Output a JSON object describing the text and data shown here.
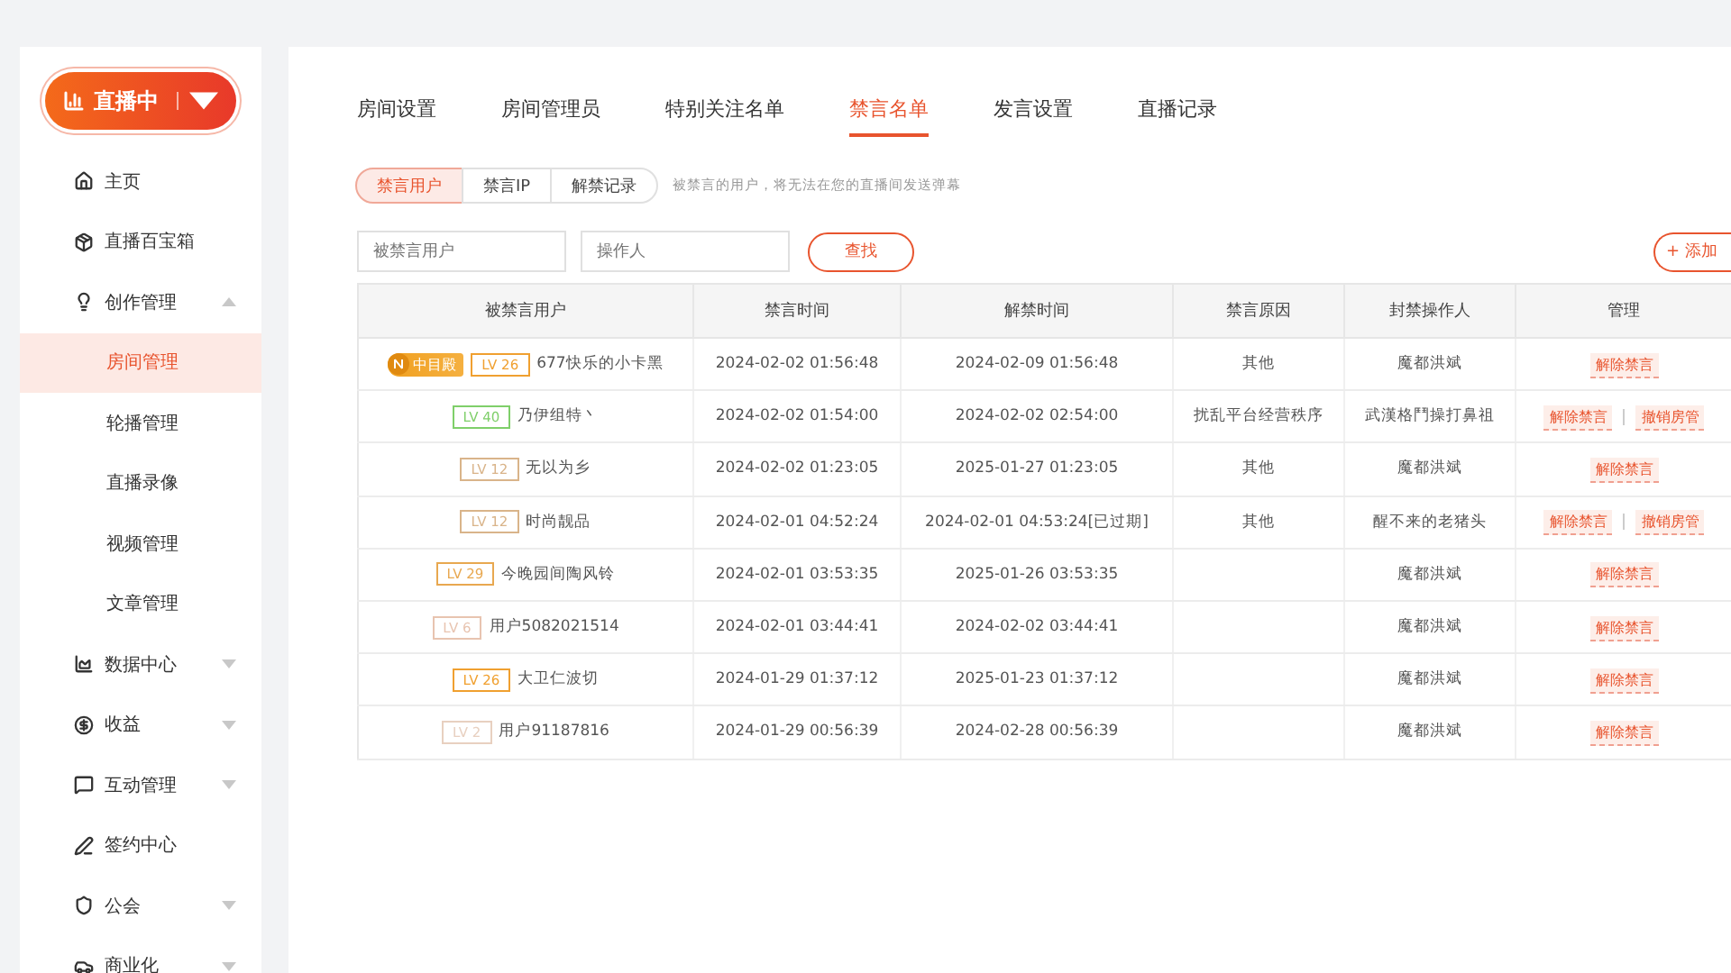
{
  "live_button": {
    "label": "直播中"
  },
  "sidebar": {
    "items": [
      {
        "label": "主页",
        "kind": "link"
      },
      {
        "label": "直播百宝箱",
        "kind": "link"
      },
      {
        "label": "创作管理",
        "kind": "group",
        "expanded": true,
        "children": [
          {
            "label": "房间管理",
            "selected": true
          },
          {
            "label": "轮播管理",
            "selected": false
          },
          {
            "label": "直播录像",
            "selected": false
          },
          {
            "label": "视频管理",
            "selected": false
          },
          {
            "label": "文章管理",
            "selected": false
          }
        ]
      },
      {
        "label": "数据中心",
        "kind": "group",
        "expanded": false
      },
      {
        "label": "收益",
        "kind": "group",
        "expanded": false
      },
      {
        "label": "互动管理",
        "kind": "group",
        "expanded": false
      },
      {
        "label": "签约中心",
        "kind": "link"
      },
      {
        "label": "公会",
        "kind": "group",
        "expanded": false
      },
      {
        "label": "商业化",
        "kind": "group",
        "expanded": false
      }
    ]
  },
  "tabs": [
    {
      "label": "房间设置",
      "selected": false
    },
    {
      "label": "房间管理员",
      "selected": false
    },
    {
      "label": "特别关注名单",
      "selected": false
    },
    {
      "label": "禁言名单",
      "selected": true
    },
    {
      "label": "发言设置",
      "selected": false
    },
    {
      "label": "直播记录",
      "selected": false
    }
  ],
  "segments": [
    {
      "label": "禁言用户",
      "selected": true
    },
    {
      "label": "禁言IP",
      "selected": false
    },
    {
      "label": "解禁记录",
      "selected": false
    }
  ],
  "hint": "被禁言的用户，将无法在您的直播间发送弹幕",
  "filters": [
    {
      "placeholder": "被禁言用户"
    },
    {
      "placeholder": "操作人"
    }
  ],
  "search_button": "查找",
  "add_button": "+ 添加",
  "table": {
    "columns": [
      "被禁言用户",
      "禁言时间",
      "解禁时间",
      "禁言原因",
      "封禁操作人",
      "管理"
    ],
    "rows": [
      {
        "fan_badge": "中目殿",
        "level": "LV 26",
        "color": "#f0a030",
        "user": "677快乐的小卡黑",
        "ban_time": "2024-02-02 01:56:48",
        "unban_time": "2024-02-09 01:56:48",
        "reason": "其他",
        "operator": "魔都洪斌",
        "actions": [
          "解除禁言"
        ]
      },
      {
        "level": "LV 40",
        "color": "#7fcf6a",
        "user": "乃伊组特丶",
        "ban_time": "2024-02-02 01:54:00",
        "unban_time": "2024-02-02 02:54:00",
        "reason": "扰乱平台经营秩序",
        "operator": "武漢格鬥操打鼻祖",
        "actions": [
          "解除禁言",
          "撤销房管"
        ]
      },
      {
        "level": "LV 12",
        "color": "#d9b48a",
        "user": "无以为乡",
        "ban_time": "2024-02-02 01:23:05",
        "unban_time": "2025-01-27 01:23:05",
        "reason": "其他",
        "operator": "魔都洪斌",
        "actions": [
          "解除禁言"
        ]
      },
      {
        "level": "LV 12",
        "color": "#d9b48a",
        "user": "时尚靓品",
        "ban_time": "2024-02-01 04:52:24",
        "unban_time": "2024-02-01 04:53:24[已过期]",
        "reason": "其他",
        "operator": "醒不来的老猪头",
        "actions": [
          "解除禁言",
          "撤销房管"
        ]
      },
      {
        "level": "LV 29",
        "color": "#e8a850",
        "user": "今晚园间陶风铃",
        "ban_time": "2024-02-01 03:53:35",
        "unban_time": "2025-01-26 03:53:35",
        "operator": "魔都洪斌",
        "actions": [
          "解除禁言"
        ]
      },
      {
        "level": "LV 6",
        "color": "#e8c4b0",
        "user": "用户5082021514",
        "ban_time": "2024-02-01 03:44:41",
        "unban_time": "2024-02-02 03:44:41",
        "operator": "魔都洪斌",
        "actions": [
          "解除禁言"
        ]
      },
      {
        "level": "LV 26",
        "color": "#f0a030",
        "user": "大卫仁波切",
        "ban_time": "2024-01-29 01:37:12",
        "unban_time": "2025-01-23 01:37:12",
        "operator": "魔都洪斌",
        "actions": [
          "解除禁言"
        ]
      },
      {
        "level": "LV 2",
        "color": "#e8d0c0",
        "user": "用户91187816",
        "ban_time": "2024-01-29 00:56:39",
        "unban_time": "2024-02-28 00:56:39",
        "operator": "魔都洪斌",
        "actions": [
          "解除禁言"
        ]
      }
    ]
  }
}
